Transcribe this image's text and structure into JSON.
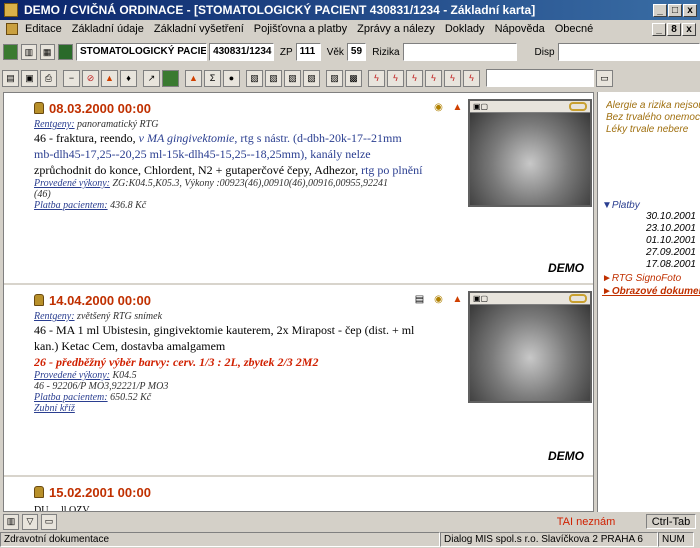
{
  "window": {
    "title": "DEMO / CVIČNÁ ORDINACE - [STOMATOLOGICKÝ PACIENT 430831/1234 - Základní karta]",
    "buttons": [
      "_",
      "□",
      "x"
    ],
    "mdi_buttons": [
      "_",
      "8",
      "x"
    ]
  },
  "menu": [
    "Editace",
    "Základní údaje",
    "Základní vyšetření",
    "Pojišťovna a platby",
    "Zprávy a nálezy",
    "Doklady",
    "Nápověda",
    "Obecné"
  ],
  "patient_bar": {
    "name": "STOMATOLOGICKÝ PACIENT",
    "rc": "430831/1234",
    "zp_label": "ZP",
    "zp": "111",
    "vek_label": "Věk",
    "vek": "59",
    "rizika_label": "Rizika",
    "rizika": "",
    "disp_label": "Disp",
    "disp": ""
  },
  "records": [
    {
      "date": "08.03.2000 00:00",
      "rentgeny_label": "Rentgeny:",
      "rentgeny": "panoramatický RTG",
      "text_1a": "46 - fraktura, reendo, ",
      "text_1b": "v MA gingivektomie",
      "text_1c": ", rtg s nástr. (d-dbh-20k-17--21mm",
      "text_2": "mb-dlh45-17,25--20,25  ml-15k-dlh45-15,25--18,25mm), kanály nelze",
      "text_3a": "zprůchodnit do konce, Chlordent, N2 + gutaperčové čepy, Adhezor, ",
      "text_3b": "rtg po plnění",
      "vykony_label": "Provedené výkony:",
      "vykony": "ZG:K04.5,K05.3,  Výkony :00923(46),00910(46),00916,00955,92241",
      "vykony_2": "(46)",
      "platba_label": "Platba pacientem:",
      "platba": "436.8 Kč",
      "demo": "DEMO"
    },
    {
      "date": "14.04.2000 00:00",
      "rentgeny_label": "Rentgeny:",
      "rentgeny": "zvětšený RTG snímek",
      "text_1": "46 - MA 1 ml Ubistesin, gingivektomie kauterem, 2x Mirapost - čep (dist. + ml",
      "text_2": "kan.) Ketac Cem, dostavba amalgamem",
      "text_red": "26 - předběžný výběr barvy: cerv. 1/3 : 2L, zbytek 2/3 2M2",
      "vykony_label": "Provedené výkony:",
      "vykony": "K04.5",
      "vykony_2": "46 - 92206/P MO3,92221/P MO3",
      "platba_label": "Platba pacientem:",
      "platba": "650.52 Kč",
      "kriz": "Zubní kříž",
      "demo": "DEMO"
    },
    {
      "date": "15.02.2001 00:00",
      "partial": "DU ... ll OZV ..."
    }
  ],
  "right_panel": {
    "alert_1": "Alergie a rizika nejsou",
    "alert_2": "Bez trvalého onemoc",
    "alert_3": "Léky trvale nebere",
    "platby_label": "▼Platby",
    "platby": [
      "30.10.2001",
      "23.10.2001",
      "01.10.2001",
      "27.09.2001",
      "17.08.2001"
    ],
    "rtg_signo": "►RTG SignoFoto",
    "obrazove": "►Obrazové dokumen"
  },
  "bottom_bar": {
    "tai": "TAI neznám",
    "ctrl_tab": "Ctrl-Tab"
  },
  "status": {
    "left": "Zdravotní dokumentace",
    "company": "Dialog MIS spol.s r.o.  Slavíčkova 2  PRAHA 6",
    "num": "NUM"
  }
}
